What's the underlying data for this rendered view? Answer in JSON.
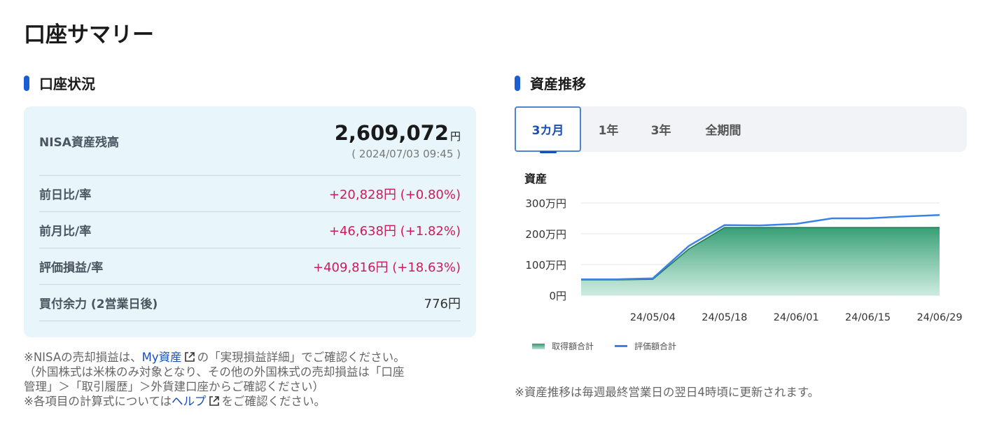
{
  "page_title": "口座サマリー",
  "account_section": {
    "heading": "口座状況",
    "nisa_balance": {
      "label": "NISA資産残高",
      "value": "2,609,072",
      "unit": "円",
      "timestamp": "( 2024/07/03 09:45 )"
    },
    "rows": [
      {
        "label": "前日比/率",
        "value": "+20,828円 (+0.80%)"
      },
      {
        "label": "前月比/率",
        "value": "+46,638円 (+1.82%)"
      },
      {
        "label": "評価損益/率",
        "value": "+409,816円 (+18.63%)"
      },
      {
        "label": "買付余力 (2営業日後)",
        "value": "776円"
      }
    ]
  },
  "notes": {
    "line1_pre": "※NISAの売却損益は、",
    "line1_link": "My資産",
    "line1_post": "の「実現損益詳細」でご確認ください。",
    "line2": "（外国株式は米株のみ対象となり、その他の外国株式の売却損益は「口座",
    "line3": "管理」＞「取引履歴」＞外貨建口座からご確認ください）",
    "line4_pre": "※各項目の計算式については",
    "line4_link": "ヘルプ",
    "line4_post": "をご確認ください。"
  },
  "asset_section": {
    "heading": "資産推移",
    "tabs": [
      {
        "label": "3カ月",
        "active": true
      },
      {
        "label": "1年",
        "active": false
      },
      {
        "label": "3年",
        "active": false
      },
      {
        "label": "全期間",
        "active": false
      }
    ],
    "note": "※資産推移は毎週最終営業日の翌日4時頃に更新されます。"
  },
  "colors": {
    "accent": "#1a5fd1",
    "positive": "#d01a5a",
    "acquisition_fill": "#2d9a6e",
    "valuation_line": "#3c82e6"
  },
  "chart_data": {
    "type": "area",
    "ylabel": "資産",
    "ylim": [
      0,
      3000000
    ],
    "y_ticks": [
      {
        "value": 0,
        "label": "0円"
      },
      {
        "value": 1000000,
        "label": "100万円"
      },
      {
        "value": 2000000,
        "label": "200万円"
      },
      {
        "value": 3000000,
        "label": "300万円"
      }
    ],
    "x_ticks": [
      "24/05/04",
      "24/05/18",
      "24/06/01",
      "24/06/15",
      "24/06/29"
    ],
    "x": [
      "24/04/20",
      "24/04/27",
      "24/05/04",
      "24/05/11",
      "24/05/18",
      "24/05/25",
      "24/06/01",
      "24/06/08",
      "24/06/15",
      "24/06/22",
      "24/06/29"
    ],
    "series": [
      {
        "name": "取得額合計",
        "style": "area",
        "values": [
          500000,
          500000,
          520000,
          1500000,
          2200000,
          2200000,
          2200000,
          2200000,
          2200000,
          2200000,
          2200000
        ]
      },
      {
        "name": "評価額合計",
        "style": "line",
        "values": [
          520000,
          520000,
          550000,
          1600000,
          2280000,
          2270000,
          2320000,
          2500000,
          2500000,
          2560000,
          2609072
        ]
      }
    ]
  }
}
